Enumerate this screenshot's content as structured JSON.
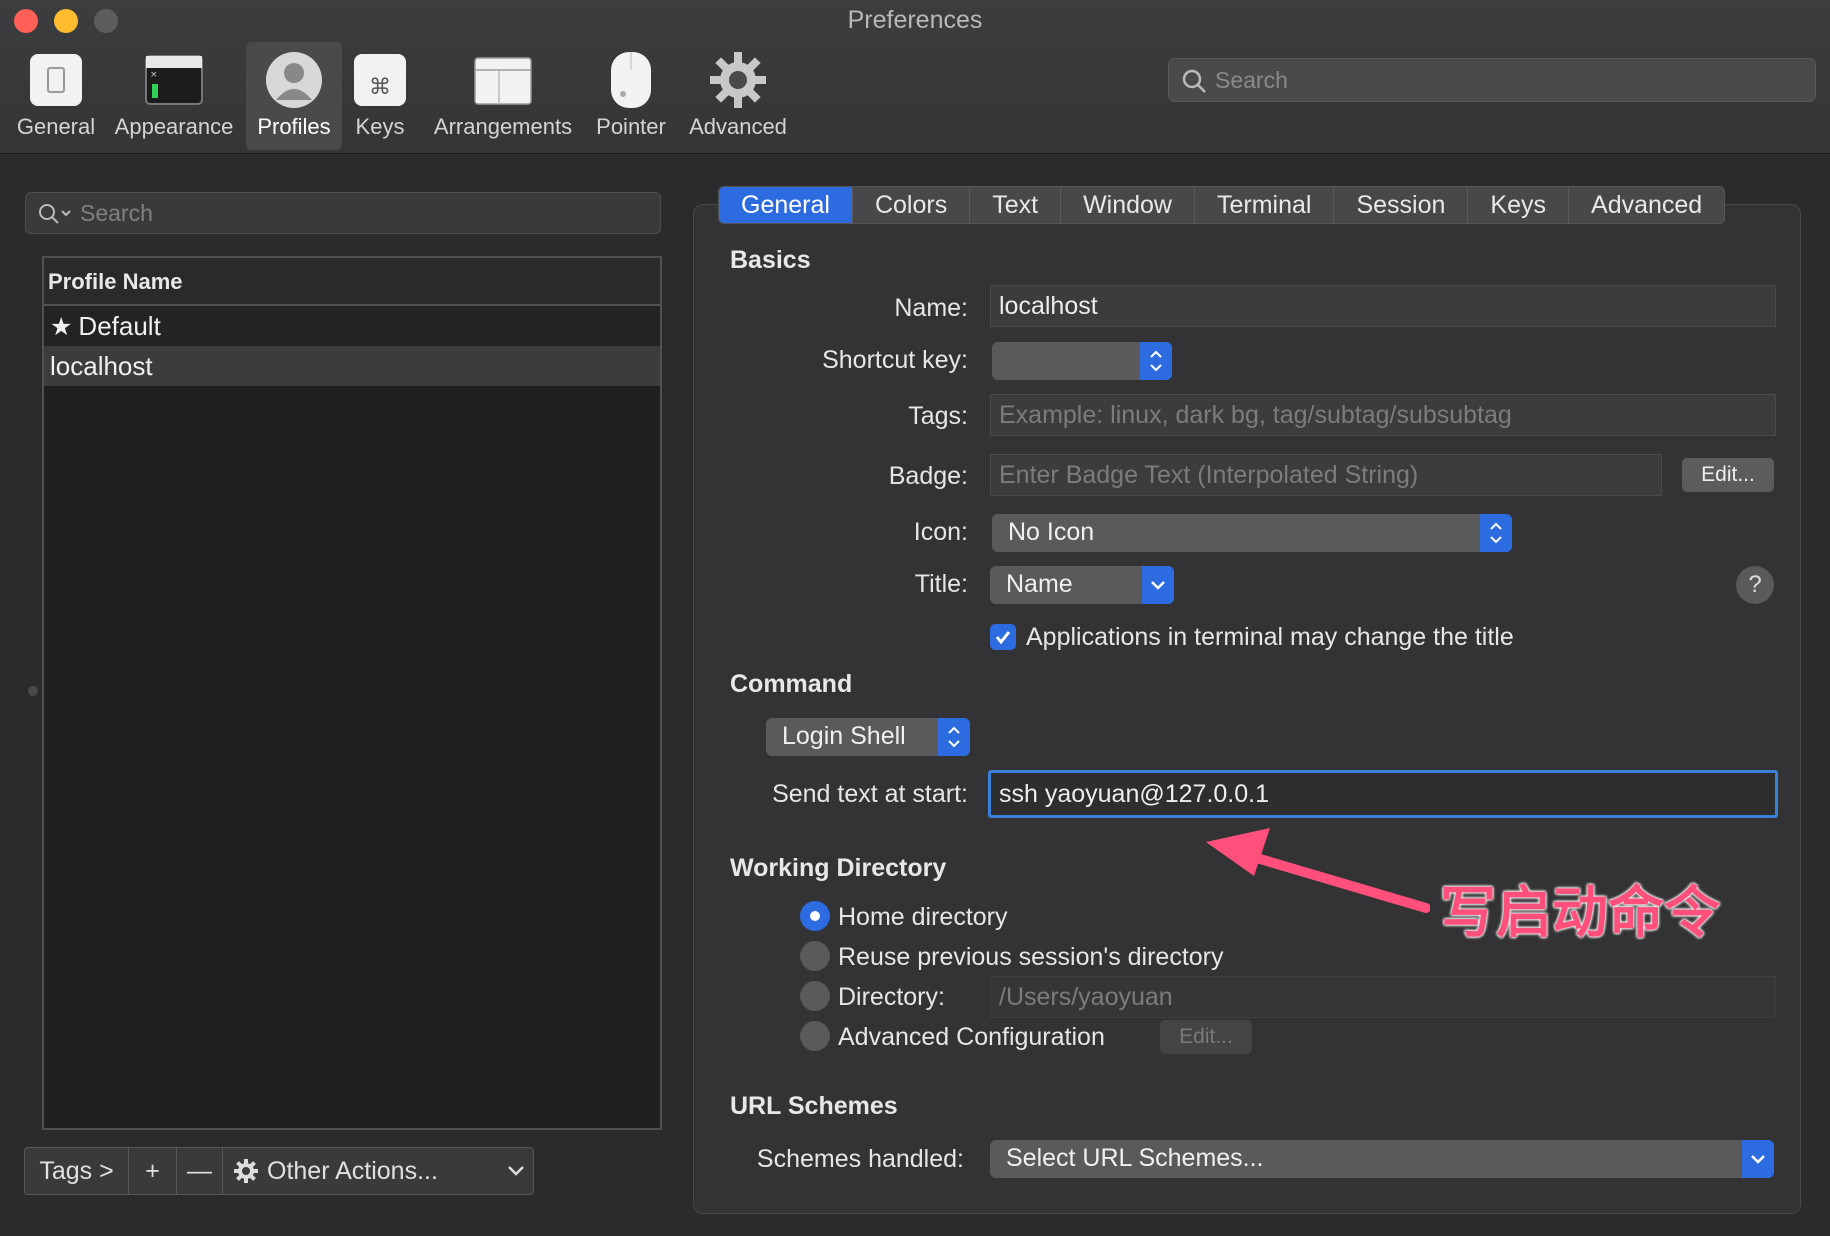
{
  "window": {
    "title": "Preferences"
  },
  "toolbar": {
    "items": [
      {
        "label": "General",
        "icon": "general-icon"
      },
      {
        "label": "Appearance",
        "icon": "appearance-icon"
      },
      {
        "label": "Profiles",
        "icon": "profiles-icon",
        "selected": true
      },
      {
        "label": "Keys",
        "icon": "keys-icon"
      },
      {
        "label": "Arrangements",
        "icon": "arrangements-icon"
      },
      {
        "label": "Pointer",
        "icon": "pointer-icon"
      },
      {
        "label": "Advanced",
        "icon": "gear-icon"
      }
    ],
    "search_placeholder": "Search"
  },
  "profiles": {
    "search_placeholder": "Search",
    "header": "Profile Name",
    "rows": [
      {
        "name": "Default",
        "is_default": true
      },
      {
        "name": "localhost",
        "selected": true
      }
    ],
    "bottom": {
      "tags": "Tags >",
      "add": "+",
      "remove": "—",
      "other_actions": "Other Actions..."
    }
  },
  "tabs": [
    "General",
    "Colors",
    "Text",
    "Window",
    "Terminal",
    "Session",
    "Keys",
    "Advanced"
  ],
  "active_tab": "General",
  "basics": {
    "title": "Basics",
    "name_label": "Name:",
    "name_value": "localhost",
    "shortcut_label": "Shortcut key:",
    "tags_label": "Tags:",
    "tags_placeholder": "Example: linux, dark bg, tag/subtag/subsubtag",
    "badge_label": "Badge:",
    "badge_placeholder": "Enter Badge Text (Interpolated String)",
    "badge_edit": "Edit...",
    "icon_label": "Icon:",
    "icon_value": "No Icon",
    "title_label": "Title:",
    "title_value": "Name",
    "help": "?",
    "allow_title_change": "Applications in terminal may change the title"
  },
  "command": {
    "title": "Command",
    "mode": "Login Shell",
    "send_text_label": "Send text at start:",
    "send_text_value": "ssh yaoyuan@127.0.0.1"
  },
  "working_directory": {
    "title": "Working Directory",
    "options": [
      "Home directory",
      "Reuse previous session's directory",
      "Directory:",
      "Advanced Configuration"
    ],
    "selected_index": 0,
    "directory_placeholder": "/Users/yaoyuan",
    "advanced_edit": "Edit..."
  },
  "url_schemes": {
    "title": "URL Schemes",
    "label": "Schemes handled:",
    "value": "Select URL Schemes..."
  },
  "annotation": {
    "text": "写启动命令",
    "color": "#ff4f7b"
  },
  "colors": {
    "accent": "#2c6be0",
    "annotation": "#ff4f7b"
  }
}
